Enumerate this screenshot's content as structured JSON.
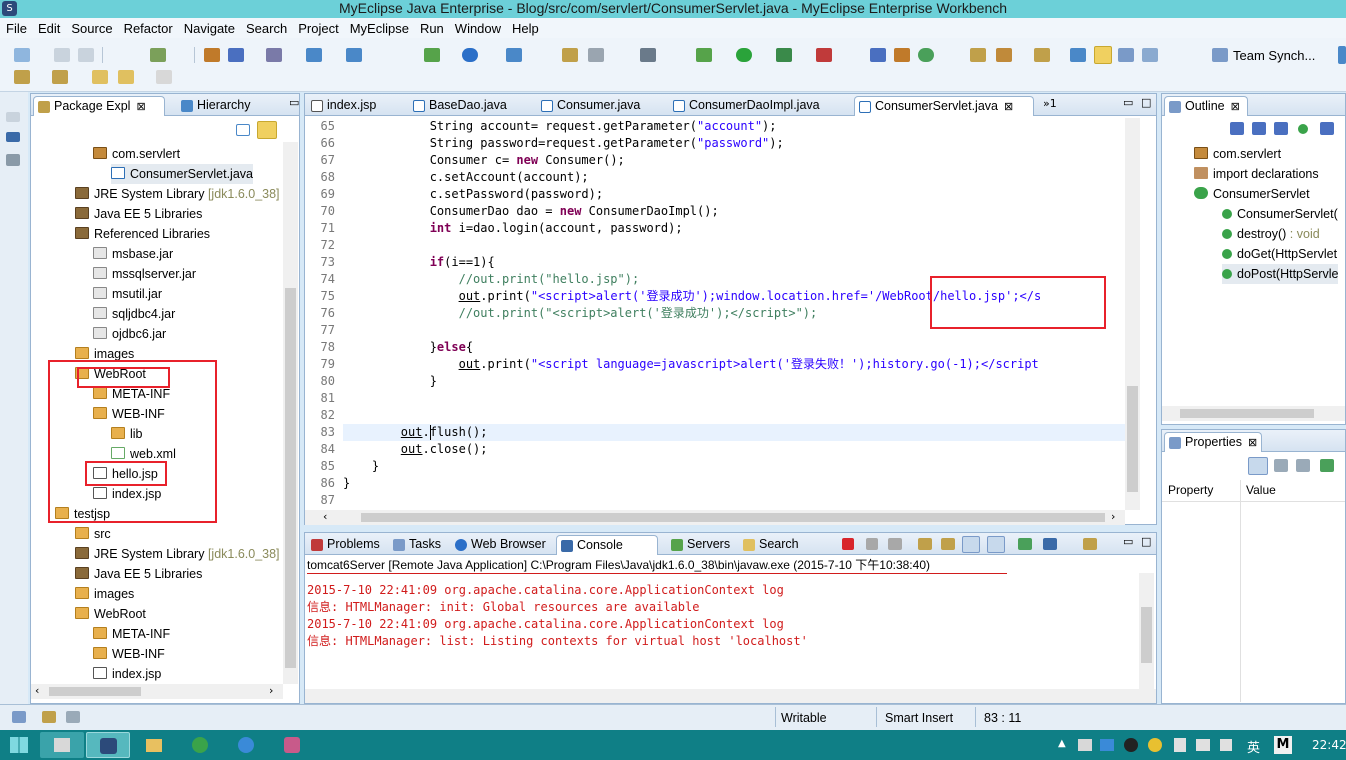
{
  "window": {
    "title": "MyEclipse Java Enterprise - Blog/src/com/servlert/ConsumerServlet.java - MyEclipse Enterprise Workbench"
  },
  "menu": [
    "File",
    "Edit",
    "Source",
    "Refactor",
    "Navigate",
    "Search",
    "Project",
    "MyEclipse",
    "Run",
    "Window",
    "Help"
  ],
  "perspective": {
    "label": "Team Synch..."
  },
  "explorer": {
    "tabs": [
      {
        "label": "Package Expl",
        "close": "⊠"
      },
      {
        "label": "Hierarchy"
      }
    ],
    "items": [
      {
        "text": "com.servlert",
        "icon": "package"
      },
      {
        "text": "ConsumerServlet.java",
        "icon": "java"
      },
      {
        "text": "JRE System Library",
        "suffix": "[jdk1.6.0_38]",
        "icon": "lib"
      },
      {
        "text": "Java EE 5 Libraries",
        "icon": "lib"
      },
      {
        "text": "Referenced Libraries",
        "icon": "lib"
      },
      {
        "text": "msbase.jar",
        "icon": "jar"
      },
      {
        "text": "mssqlserver.jar",
        "icon": "jar"
      },
      {
        "text": "msutil.jar",
        "icon": "jar"
      },
      {
        "text": "sqljdbc4.jar",
        "icon": "jar"
      },
      {
        "text": "ojdbc6.jar",
        "icon": "jar"
      },
      {
        "text": "images",
        "icon": "folder"
      },
      {
        "text": "WebRoot",
        "icon": "folder"
      },
      {
        "text": "META-INF",
        "icon": "folder"
      },
      {
        "text": "WEB-INF",
        "icon": "folder"
      },
      {
        "text": "lib",
        "icon": "folder"
      },
      {
        "text": "web.xml",
        "icon": "xml"
      },
      {
        "text": "hello.jsp",
        "icon": "jsp"
      },
      {
        "text": "index.jsp",
        "icon": "jsp"
      },
      {
        "text": "testjsp",
        "icon": "project"
      },
      {
        "text": "src",
        "icon": "folder"
      },
      {
        "text": "JRE System Library",
        "suffix": "[jdk1.6.0_38]",
        "icon": "lib"
      },
      {
        "text": "Java EE 5 Libraries",
        "icon": "lib"
      },
      {
        "text": "images",
        "icon": "folder"
      },
      {
        "text": "WebRoot",
        "icon": "folder"
      },
      {
        "text": "META-INF",
        "icon": "folder"
      },
      {
        "text": "WEB-INF",
        "icon": "folder"
      },
      {
        "text": "index.jsp",
        "icon": "jsp"
      }
    ]
  },
  "editor": {
    "tabs": [
      {
        "label": "index.jsp"
      },
      {
        "label": "BaseDao.java"
      },
      {
        "label": "Consumer.java"
      },
      {
        "label": "ConsumerDaoImpl.java"
      },
      {
        "label": "ConsumerServlet.java",
        "close": "⊠"
      }
    ],
    "overflow": "»1",
    "line_numbers": [
      "65",
      "66",
      "67",
      "68",
      "69",
      "70",
      "71",
      "72",
      "73",
      "74",
      "75",
      "76",
      "77",
      "78",
      "79",
      "80",
      "81",
      "82",
      "83",
      "84",
      "85",
      "86",
      "87"
    ]
  },
  "outline": {
    "tab": "Outline",
    "items": [
      {
        "text": "com.servlert"
      },
      {
        "text": "import declarations"
      },
      {
        "text": "ConsumerServlet"
      },
      {
        "text": "ConsumerServlet("
      },
      {
        "text": "destroy()",
        "suffix": " : void"
      },
      {
        "text": "doGet(HttpServlet"
      },
      {
        "text": "doPost(HttpServle"
      }
    ]
  },
  "properties": {
    "tab": "Properties",
    "col1": "Property",
    "col2": "Value"
  },
  "console": {
    "tabs": [
      "Problems",
      "Tasks",
      "Web Browser",
      "Console",
      "Servers",
      "Search"
    ],
    "header": "tomcat6Server [Remote Java Application] C:\\Program Files\\Java\\jdk1.6.0_38\\bin\\javaw.exe (2015-7-10 下午10:38:40)",
    "lines": [
      "2015-7-10 22:41:09 org.apache.catalina.core.ApplicationContext log",
      "信息: HTMLManager: init: Global resources are available",
      "2015-7-10 22:41:09 org.apache.catalina.core.ApplicationContext log",
      "信息: HTMLManager: list: Listing contexts for virtual host 'localhost'"
    ]
  },
  "status": {
    "mode": "Writable",
    "insert": "Smart Insert",
    "position": "83 : 11"
  },
  "taskbar": {
    "ime": "英",
    "clock": "22:42"
  },
  "colors": {
    "highlight": "#e8212b",
    "titlebar": "#6cd0d8",
    "taskbar": "#0f7f86"
  }
}
